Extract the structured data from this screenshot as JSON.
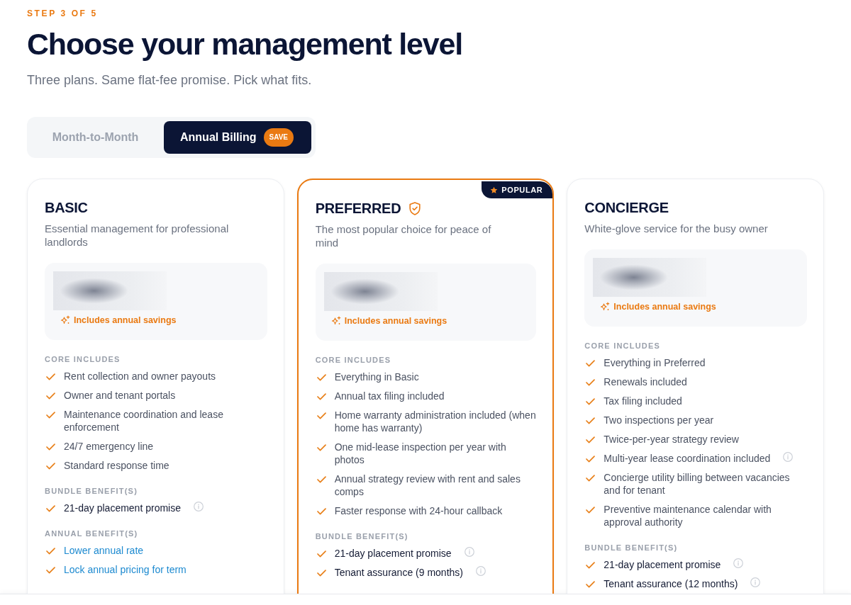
{
  "step": "STEP 3 OF 5",
  "title": "Choose your management level",
  "subtitle": "Three plans. Same flat-fee promise. Pick what fits.",
  "billing_options": [
    {
      "label": "Month-to-Month",
      "selected": false
    },
    {
      "label": "Annual Billing",
      "selected": true,
      "badge": "SAVE"
    }
  ],
  "plans": [
    {
      "name": "BASIC",
      "highlighted": false,
      "description": "Essential management for professional landlords",
      "savings_note": "Includes annual savings",
      "sections": [
        {
          "heading": "CORE INCLUDES",
          "kind": "core",
          "items": [
            {
              "text": "Rent collection and owner payouts",
              "info": false
            },
            {
              "text": "Owner and tenant portals",
              "info": false
            },
            {
              "text": "Maintenance coordination and lease enforcement",
              "info": false
            },
            {
              "text": "24/7 emergency line",
              "info": false
            },
            {
              "text": "Standard response time",
              "info": false
            }
          ]
        },
        {
          "heading": "BUNDLE BENEFIT(S)",
          "kind": "bundle",
          "items": [
            {
              "text": "21-day placement promise",
              "info": true
            }
          ]
        },
        {
          "heading": "ANNUAL BENEFIT(S)",
          "kind": "annual",
          "items": [
            {
              "text": "Lower annual rate",
              "info": false
            },
            {
              "text": "Lock annual pricing for term",
              "info": false
            }
          ]
        }
      ]
    },
    {
      "name": "PREFERRED",
      "highlighted": true,
      "badge": "POPULAR",
      "description": "The most popular choice for peace of mind",
      "savings_note": "Includes annual savings",
      "sections": [
        {
          "heading": "CORE INCLUDES",
          "kind": "core",
          "items": [
            {
              "text": "Everything in Basic",
              "info": false
            },
            {
              "text": "Annual tax filing included",
              "info": false
            },
            {
              "text": "Home warranty administration included (when home has warranty)",
              "info": false
            },
            {
              "text": "One mid-lease inspection per year with photos",
              "info": false
            },
            {
              "text": "Annual strategy review with rent and sales comps",
              "info": false
            },
            {
              "text": "Faster response with 24-hour callback",
              "info": false
            }
          ]
        },
        {
          "heading": "BUNDLE BENEFIT(S)",
          "kind": "bundle",
          "items": [
            {
              "text": "21-day placement promise",
              "info": true
            },
            {
              "text": "Tenant assurance (9 months)",
              "info": true
            }
          ]
        }
      ]
    },
    {
      "name": "CONCIERGE",
      "highlighted": false,
      "description": "White-glove service for the busy owner",
      "savings_note": "Includes annual savings",
      "sections": [
        {
          "heading": "CORE INCLUDES",
          "kind": "core",
          "items": [
            {
              "text": "Everything in Preferred",
              "info": false
            },
            {
              "text": "Renewals included",
              "info": false
            },
            {
              "text": "Tax filing included",
              "info": false
            },
            {
              "text": "Two inspections per year",
              "info": false
            },
            {
              "text": "Twice-per-year strategy review",
              "info": false
            },
            {
              "text": "Multi-year lease coordination included",
              "info": true
            },
            {
              "text": "Concierge utility billing between vacancies and for tenant",
              "info": false
            },
            {
              "text": "Preventive maintenance calendar with approval authority",
              "info": false
            }
          ]
        },
        {
          "heading": "BUNDLE BENEFIT(S)",
          "kind": "bundle",
          "items": [
            {
              "text": "21-day placement promise",
              "info": true
            },
            {
              "text": "Tenant assurance (12 months)",
              "info": true
            }
          ]
        }
      ]
    }
  ]
}
